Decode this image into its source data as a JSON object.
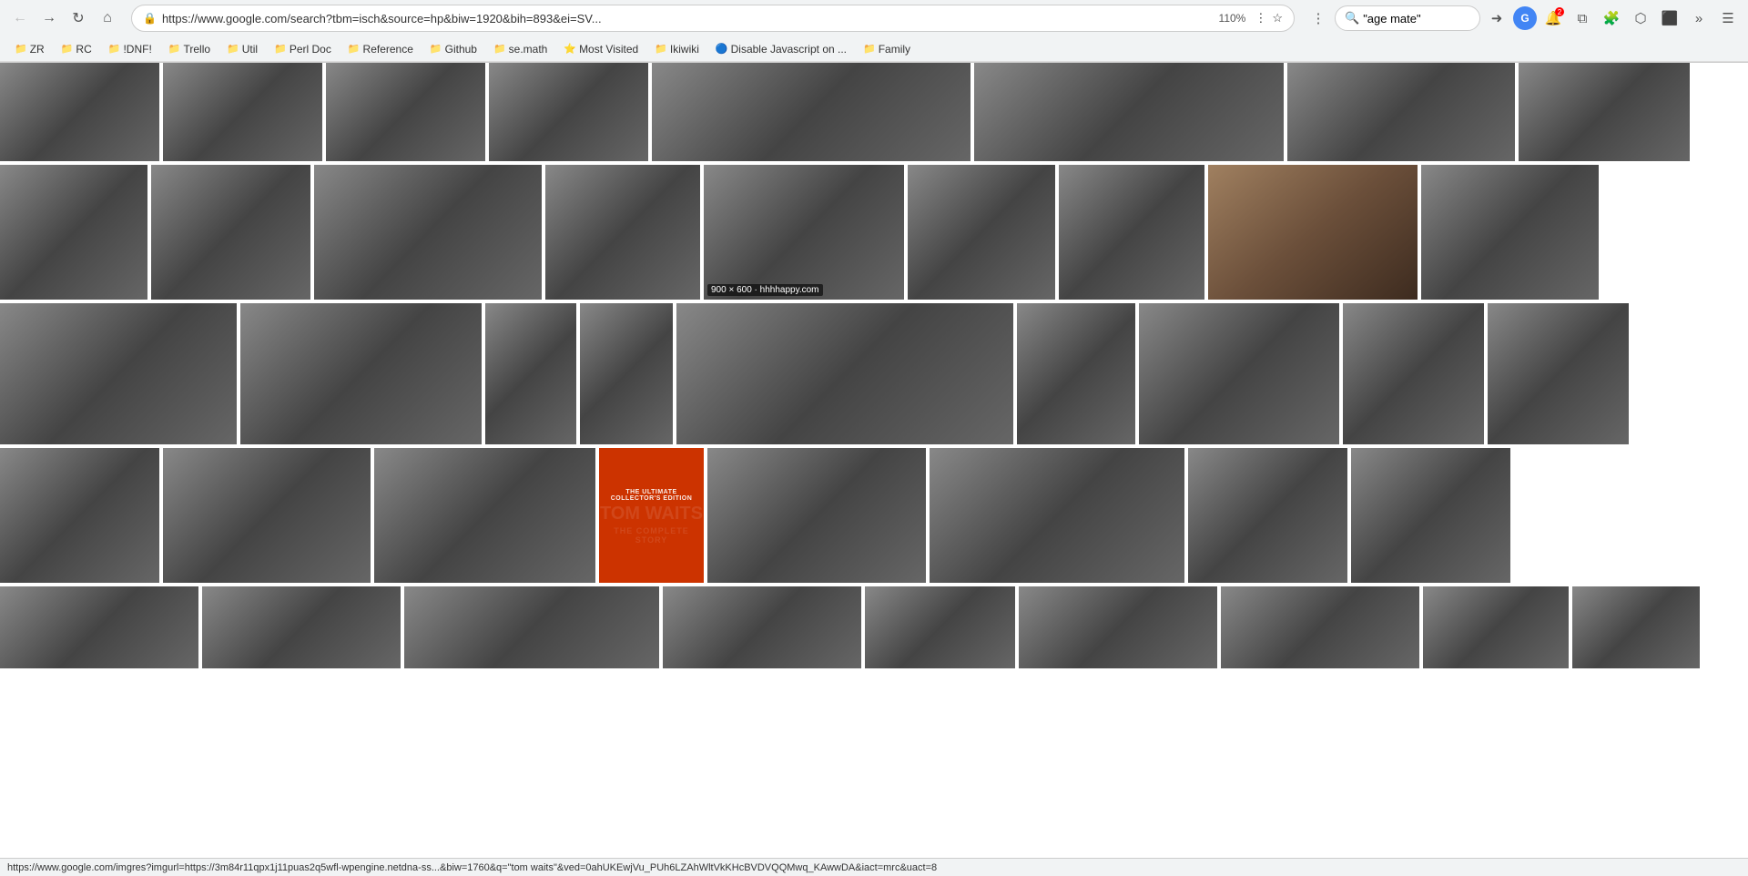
{
  "browser": {
    "url": "https://www.google.com/search?tbm=isch&source=hp&biw=1920&bih=893&ei=SV...",
    "zoom": "110%",
    "search_query": "\"age mate\"",
    "status_text": "https://www.google.com/imgres?imgurl=https://3m84r11qpx1j11puas2q5wfl-wpengine.netdna-ss...&biw=1760&q=\"tom waits\"&ved=0ahUKEwjVu_PUh6LZAhWltVkKHcBVDVQQMwq_KAwwDA&iact=mrc&uact=8"
  },
  "bookmarks": [
    {
      "id": "zr",
      "label": "ZR",
      "icon": "📁"
    },
    {
      "id": "rc",
      "label": "RC",
      "icon": "📁"
    },
    {
      "id": "idnf",
      "label": "!DNF!",
      "icon": "📁"
    },
    {
      "id": "trello",
      "label": "Trello",
      "icon": "📁"
    },
    {
      "id": "util",
      "label": "Util",
      "icon": "📁"
    },
    {
      "id": "perl-doc",
      "label": "Perl Doc",
      "icon": "📁"
    },
    {
      "id": "reference",
      "label": "Reference",
      "icon": "📁"
    },
    {
      "id": "github",
      "label": "Github",
      "icon": "📁"
    },
    {
      "id": "semath",
      "label": "se.math",
      "icon": "📁"
    },
    {
      "id": "most-visited",
      "label": "Most Visited",
      "icon": "⭐"
    },
    {
      "id": "ikiwiki",
      "label": "Ikiwiki",
      "icon": "📁"
    },
    {
      "id": "disable-js",
      "label": "Disable Javascript on ...",
      "icon": "🔵"
    },
    {
      "id": "family",
      "label": "Family",
      "icon": "📁"
    }
  ],
  "grid": {
    "caption_900x600": "900 × 600 · hhhhappy.com",
    "magazine": {
      "collector": "THE ULTIMATE COLLECTOR'S EDITION",
      "title": "TOM WAITS",
      "subtitle": "THE COMPLETE STORY"
    }
  }
}
